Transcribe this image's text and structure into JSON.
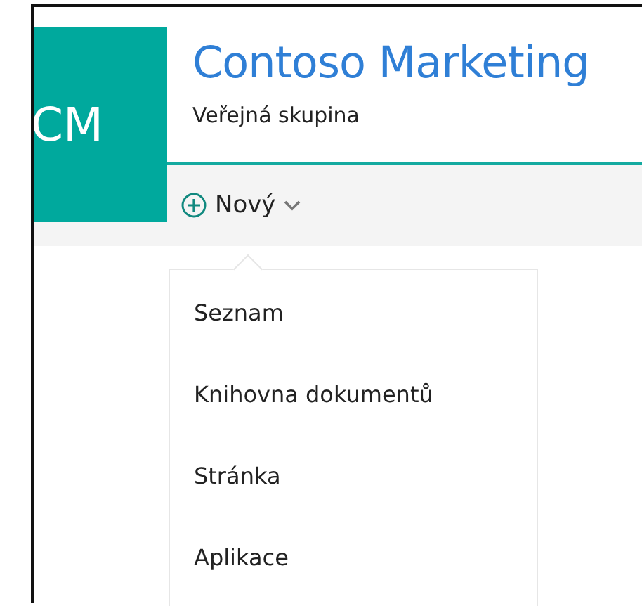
{
  "site": {
    "initials": "CM",
    "title": "Contoso Marketing",
    "subtitle": "Veřejná skupina"
  },
  "toolbar": {
    "new_button": {
      "label": "Nový",
      "expanded": true
    }
  },
  "menu": {
    "items": [
      {
        "label": "Seznam"
      },
      {
        "label": "Knihovna dokumentů"
      },
      {
        "label": "Stránka"
      },
      {
        "label": "Aplikace"
      }
    ]
  }
}
